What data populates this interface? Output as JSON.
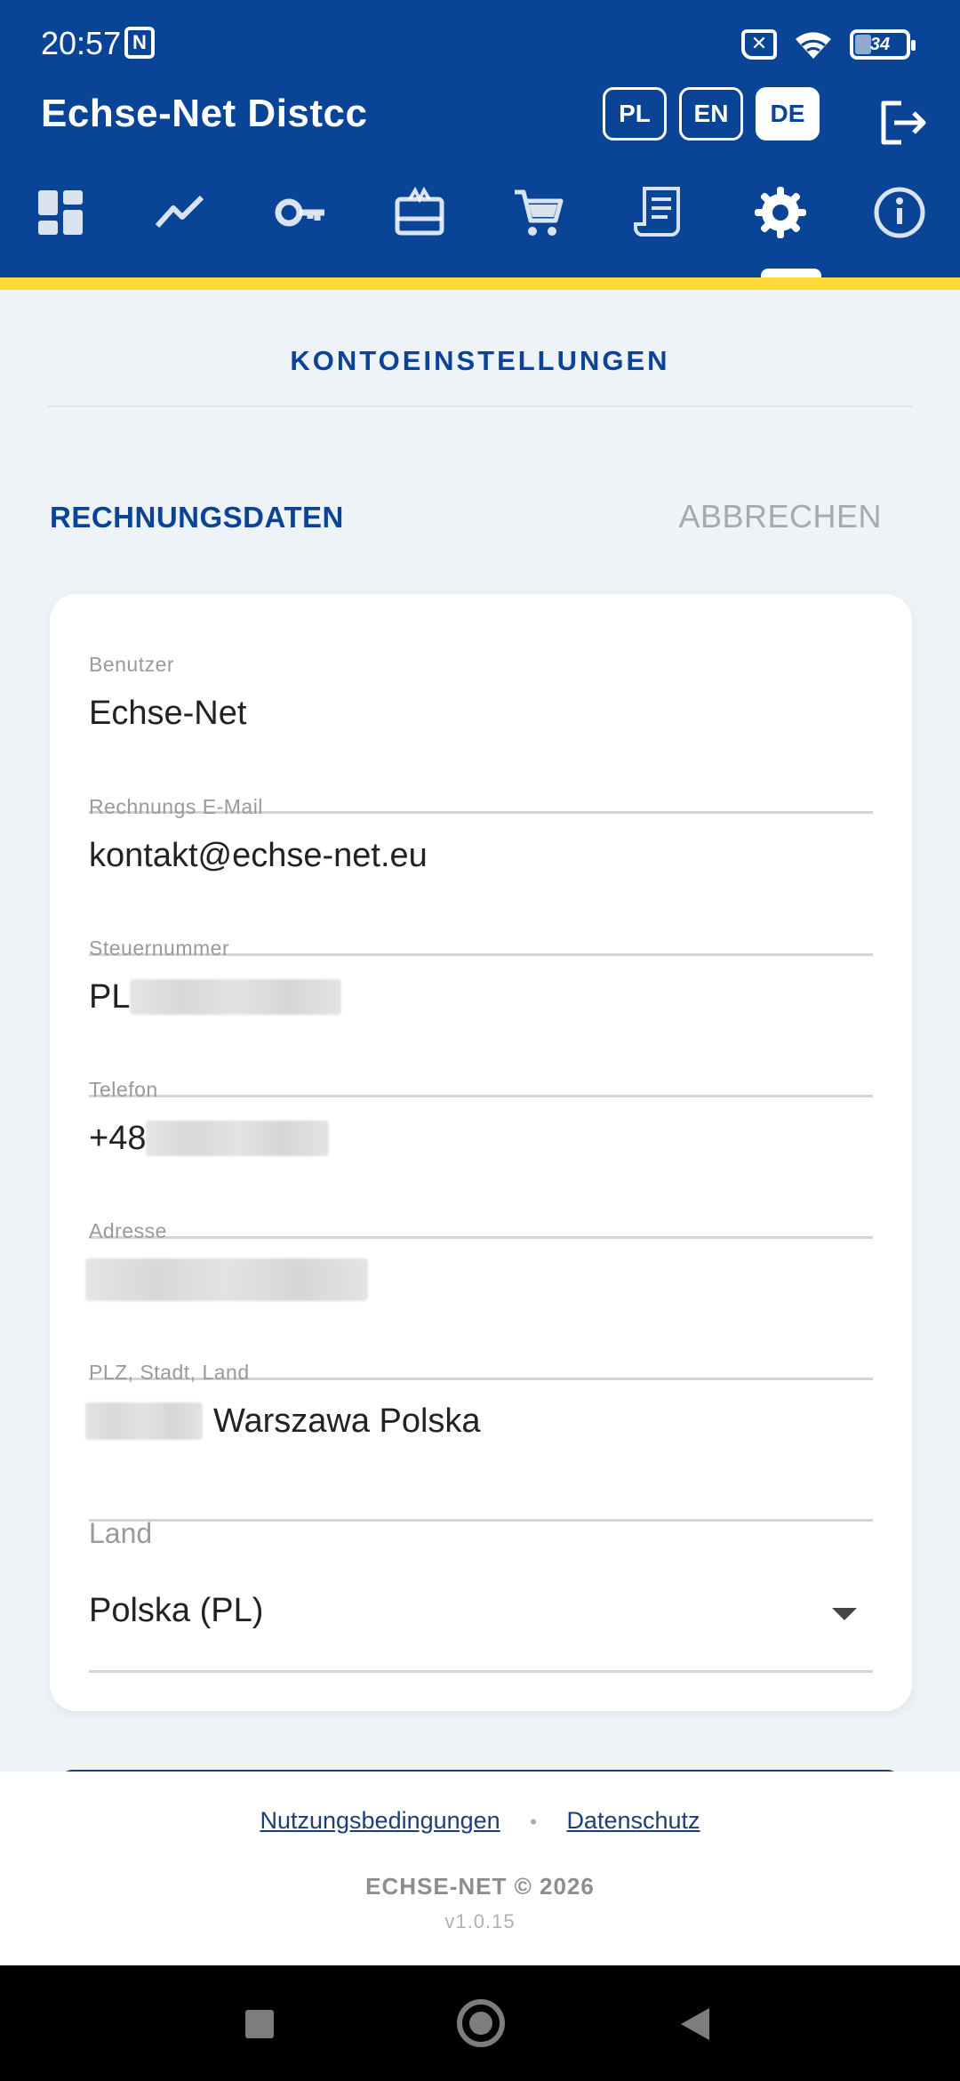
{
  "status_bar": {
    "time": "20:57",
    "battery": "34"
  },
  "app": {
    "title": "Echse-Net Distcc"
  },
  "languages": [
    "PL",
    "EN",
    "DE"
  ],
  "active_language": "DE",
  "nav_icons": [
    "dashboard-icon",
    "chart-icon",
    "key-icon",
    "gift-card-icon",
    "cart-icon",
    "receipt-icon",
    "gear-icon",
    "info-icon"
  ],
  "active_nav": "gear-icon",
  "page": {
    "title": "KONTOEINSTELLUNGEN",
    "tab_billing": "RECHNUNGSDATEN",
    "tab_cancel": "ABBRECHEN"
  },
  "form": {
    "user_label": "Benutzer",
    "user_value": "Echse-Net",
    "email_label": "Rechnungs E-Mail",
    "email_value": "kontakt@echse-net.eu",
    "tax_label": "Steuernummer",
    "tax_prefix": "PL",
    "phone_label": "Telefon",
    "phone_prefix": "+48",
    "address_label": "Adresse",
    "city_label": "PLZ, Stadt, Land",
    "city_value": "Warszawa Polska",
    "country_label": "Land",
    "country_value": "Polska (PL)"
  },
  "footer": {
    "terms": "Nutzungsbedingungen",
    "separator": "•",
    "privacy": "Datenschutz",
    "copyright": "ECHSE-NET © 2026",
    "version": "v1.0.15"
  },
  "colors": {
    "primary": "#0a4497",
    "accent": "#ffd83a"
  }
}
